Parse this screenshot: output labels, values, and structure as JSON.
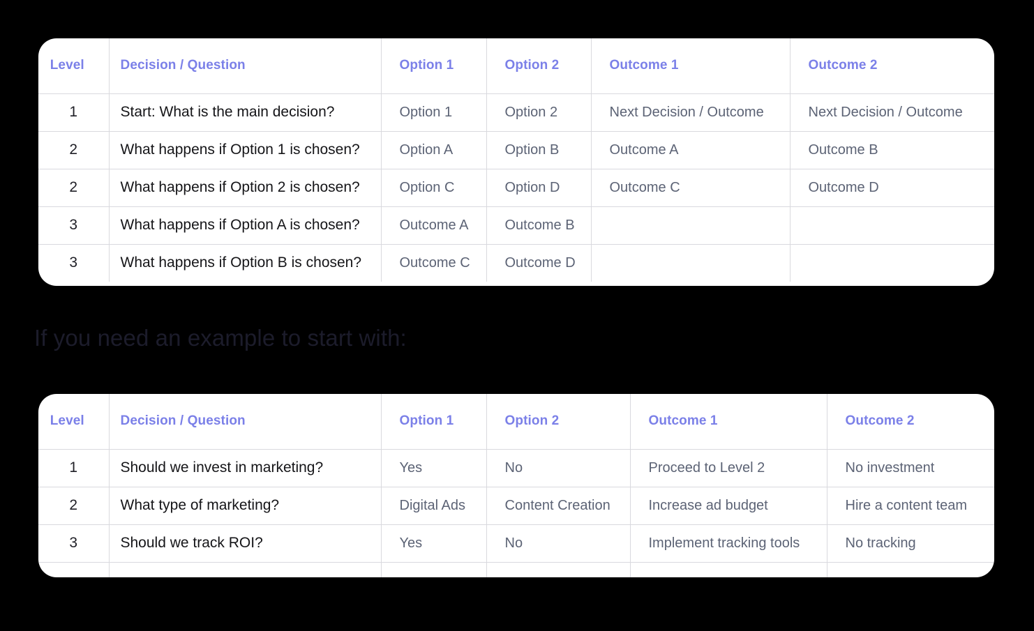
{
  "background_color": "#000000",
  "accent_header_color": "#7b80e8",
  "border_color": "#d9d9de",
  "body_text_color": "#5c6375",
  "primary_text_color": "#151518",
  "section_heading": "If you need an example to start with:",
  "table_one": {
    "name": "decision-tree-template-table",
    "columns": [
      "Level",
      "Decision / Question",
      "Option 1",
      "Option 2",
      "Outcome 1",
      "Outcome 2"
    ],
    "rows": [
      {
        "level": "1",
        "decision": "Start: What is the main decision?",
        "option1": "Option 1",
        "option2": "Option 2",
        "outcome1": "Next Decision / Outcome",
        "outcome2": "Next Decision / Outcome"
      },
      {
        "level": "2",
        "decision": "What happens if Option 1 is chosen?",
        "option1": "Option A",
        "option2": "Option B",
        "outcome1": "Outcome A",
        "outcome2": "Outcome B"
      },
      {
        "level": "2",
        "decision": "What happens if Option 2 is chosen?",
        "option1": "Option C",
        "option2": "Option D",
        "outcome1": "Outcome C",
        "outcome2": "Outcome D"
      },
      {
        "level": "3",
        "decision": "What happens if Option A is chosen?",
        "option1": "Outcome A",
        "option2": "Outcome B",
        "outcome1": "",
        "outcome2": ""
      },
      {
        "level": "3",
        "decision": "What happens if Option B is chosen?",
        "option1": "Outcome C",
        "option2": "Outcome D",
        "outcome1": "",
        "outcome2": ""
      }
    ]
  },
  "table_two": {
    "name": "decision-tree-example-table",
    "columns": [
      "Level",
      "Decision / Question",
      "Option 1",
      "Option 2",
      "Outcome 1",
      "Outcome 2"
    ],
    "rows": [
      {
        "level": "1",
        "decision": "Should we invest in marketing?",
        "option1": "Yes",
        "option2": "No",
        "outcome1": "Proceed to Level 2",
        "outcome2": "No investment"
      },
      {
        "level": "2",
        "decision": "What type of marketing?",
        "option1": "Digital Ads",
        "option2": "Content Creation",
        "outcome1": "Increase ad budget",
        "outcome2": "Hire a content team"
      },
      {
        "level": "3",
        "decision": "Should we track ROI?",
        "option1": "Yes",
        "option2": "No",
        "outcome1": "Implement tracking tools",
        "outcome2": "No tracking"
      }
    ]
  }
}
